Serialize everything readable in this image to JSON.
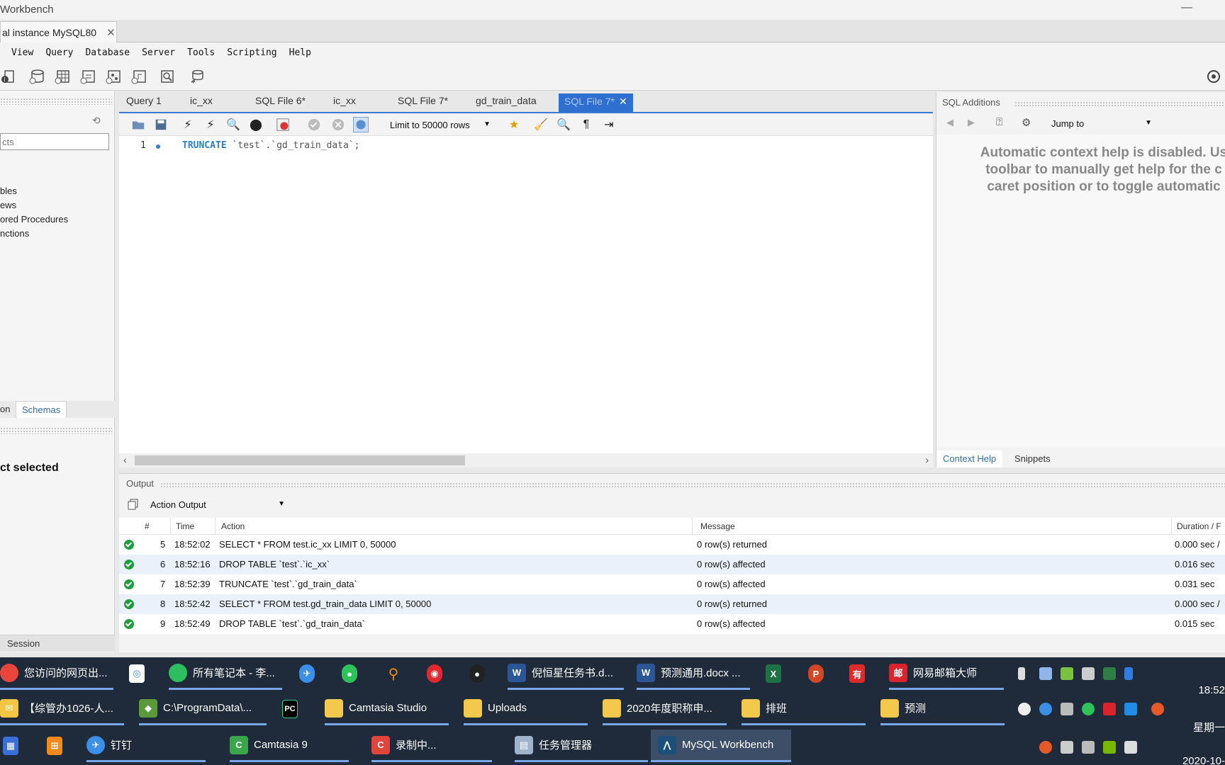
{
  "window": {
    "title": "Workbench",
    "minimize_glyph": "—"
  },
  "connection_tab": {
    "label": "al instance MySQL80",
    "close_glyph": "✕"
  },
  "menu": [
    "View",
    "Query",
    "Database",
    "Server",
    "Tools",
    "Scripting",
    "Help"
  ],
  "sidebar": {
    "filter_placeholder": "cts",
    "tree": [
      "bles",
      "ews",
      "ored Procedures",
      "nctions"
    ],
    "tabs": [
      "on",
      "Schemas"
    ],
    "info_text": "ct selected",
    "session_tab": "Session"
  },
  "editor_tabs": [
    {
      "label": "Query 1"
    },
    {
      "label": "ic_xx"
    },
    {
      "label": "SQL File 6*"
    },
    {
      "label": "ic_xx"
    },
    {
      "label": "SQL File 7*"
    },
    {
      "label": "gd_train_data"
    },
    {
      "label": "SQL File 7*",
      "active": true,
      "close": "✕"
    }
  ],
  "editor_toolbar": {
    "limit_label": "Limit to 50000 rows"
  },
  "editor": {
    "line_number": "1",
    "keyword": "TRUNCATE",
    "rest": " `test`.`gd_train_data`;"
  },
  "sql_additions": {
    "title": "SQL Additions",
    "jump_to": "Jump to",
    "help_lines": [
      "Automatic context help is disabled. Us",
      "toolbar to manually get help for the c",
      "caret position or to toggle automatic"
    ],
    "tabs": [
      "Context Help",
      "Snippets"
    ]
  },
  "output": {
    "title": "Output",
    "selector": "Action Output",
    "columns": [
      "#",
      "Time",
      "Action",
      "Message",
      "Duration / F"
    ],
    "rows": [
      {
        "num": "5",
        "time": "18:52:02",
        "action": "SELECT * FROM test.ic_xx LIMIT 0, 50000",
        "message": "0 row(s) returned",
        "duration": "0.000 sec /"
      },
      {
        "num": "6",
        "time": "18:52:16",
        "action": "DROP TABLE `test`.`ic_xx`",
        "message": "0 row(s) affected",
        "duration": "0.016 sec"
      },
      {
        "num": "7",
        "time": "18:52:39",
        "action": "TRUNCATE `test`.`gd_train_data`",
        "message": "0 row(s) affected",
        "duration": "0.031 sec"
      },
      {
        "num": "8",
        "time": "18:52:42",
        "action": "SELECT * FROM test.gd_train_data LIMIT 0, 50000",
        "message": "0 row(s) returned",
        "duration": "0.000 sec /"
      },
      {
        "num": "9",
        "time": "18:52:49",
        "action": "DROP TABLE `test`.`gd_train_data`",
        "message": "0 row(s) affected",
        "duration": "0.015 sec"
      }
    ]
  },
  "taskbar": {
    "row1": [
      "您访问的网页出...",
      "所有笔记本 - 李...",
      "倪恒星任务书.d...",
      "预测通用.docx ...",
      "网易邮箱大师"
    ],
    "row2": [
      "【综管办1026-人...",
      "C:\\ProgramData\\...",
      "Camtasia Studio",
      "Uploads",
      "2020年度职称申...",
      "排班",
      "预测"
    ],
    "row3": [
      "钉钉",
      "Camtasia 9",
      "录制中...",
      "任务管理器",
      "MySQL Workbench"
    ],
    "clock": [
      "18:52",
      "星期一",
      "2020-10-"
    ]
  },
  "colors": {
    "accent": "#2f6fcf",
    "taskbar": "#1f2a3a",
    "success": "#1e9d3c",
    "keyword": "#2a7fd0"
  }
}
